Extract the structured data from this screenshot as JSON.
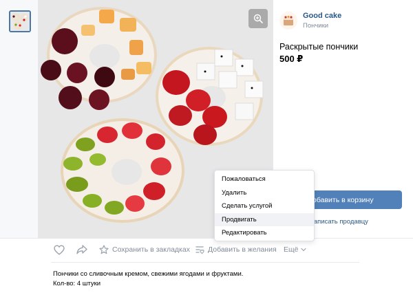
{
  "shop": {
    "name": "Good cake",
    "type": "Пончики"
  },
  "product": {
    "title": "Раскрытые пончики",
    "price": "500 ₽",
    "description": "Пончики со сливочным кремом, свежими ягодами и фруктами.",
    "quantity": "Кол-во: 4 штуки"
  },
  "buttons": {
    "add_to_cart": "обавить в корзину",
    "write_seller": "Написать продавцу"
  },
  "actions": {
    "bookmark": "Сохранить в закладках",
    "wishlist": "Добавить в желания",
    "more": "Ещё"
  },
  "menu": {
    "items": [
      {
        "label": "Пожаловаться"
      },
      {
        "label": "Удалить"
      },
      {
        "label": "Сделать услугой"
      },
      {
        "label": "Продвигать",
        "hovered": true
      },
      {
        "label": "Редактировать"
      }
    ]
  },
  "icons": [
    "zoom-in-icon",
    "heart-icon",
    "share-icon",
    "star-icon",
    "wishlist-icon",
    "chevron-down-icon"
  ],
  "colors": {
    "accent": "#5181b8",
    "link": "#2a5885",
    "muted": "#818c99"
  }
}
